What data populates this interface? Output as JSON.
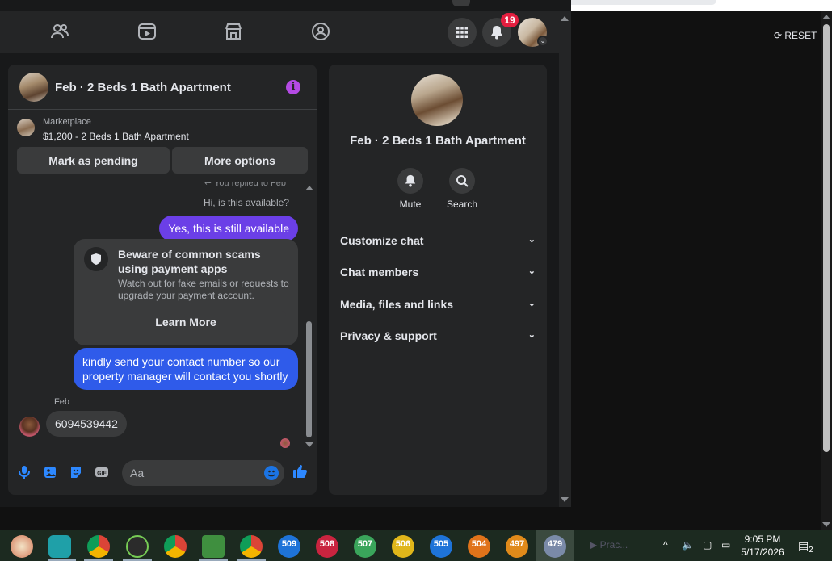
{
  "header": {
    "notification_count": "19"
  },
  "chat": {
    "title": "Feb · 2 Beds 1 Bath Apartment",
    "marketplace_label": "Marketplace",
    "listing": "$1,200 - 2 Beds 1 Bath Apartment",
    "mark_pending": "Mark as pending",
    "more_options": "More options",
    "reply_note": "You replied to Feb",
    "quoted_message": "Hi, is this available?",
    "msg_available": "Yes, this is still available",
    "scam_title": "Beware of common scams using payment apps",
    "scam_body": "Watch out for fake emails or requests to upgrade your payment account.",
    "learn_more": "Learn More",
    "msg_contact": "kindly send your contact number so our property manager will contact you shortly",
    "sender_name": "Feb",
    "msg_number": "6094539442",
    "input_placeholder": "Aa"
  },
  "info": {
    "title": "Feb · 2 Beds 1 Bath Apartment",
    "mute": "Mute",
    "search": "Search",
    "sections": [
      "Customize chat",
      "Chat members",
      "Media, files and links",
      "Privacy & support"
    ]
  },
  "right": {
    "reset": "RESET"
  },
  "taskbar": {
    "badges": [
      "509",
      "508",
      "507",
      "506",
      "505",
      "504",
      "497",
      "479"
    ],
    "faded_label": "Prac...",
    "time": "9:05 PM",
    "date": "5/17/2026",
    "notif_count": "2"
  },
  "colors": {
    "accent_purple": "#6b3fe7",
    "accent_blue": "#2f5bea",
    "brand_blue": "#1b74e4",
    "badge_red": "#e41e3f"
  }
}
